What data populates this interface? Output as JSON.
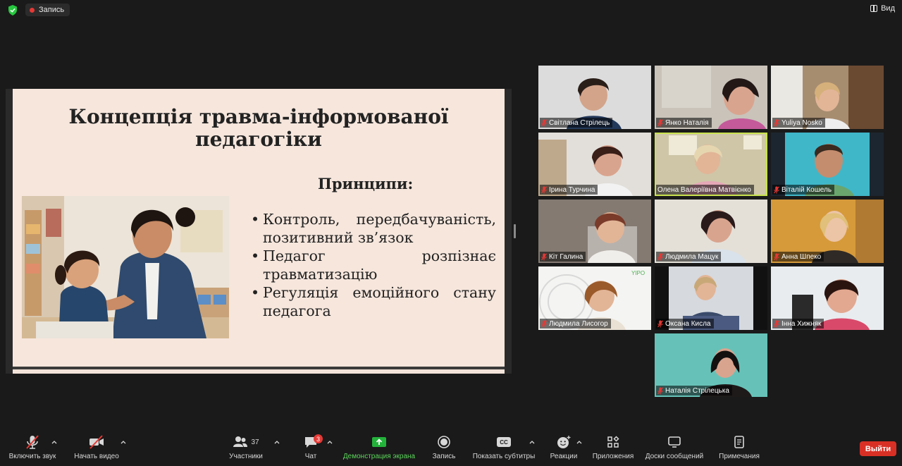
{
  "top_bar": {
    "recording_label": "Запись",
    "view_label": "Вид"
  },
  "slide": {
    "title_line1": "Концепція травма-інформованої",
    "title_line2": "педагогіки",
    "principles_heading": "Принципи:",
    "bullets": [
      "Контроль, передбачуваність, позитивний зв’язок",
      "Педагог розпізнає травматизацію",
      "Регуляція емоційного стану педагога"
    ]
  },
  "participants": [
    {
      "name": "Світлана Стрілець"
    },
    {
      "name": "Янко Наталія"
    },
    {
      "name": "Yuliya Nosko"
    },
    {
      "name": "Ірина Турчина"
    },
    {
      "name": "Олена Валеріївна Матвієнко"
    },
    {
      "name": "Віталій Кошель"
    },
    {
      "name": "Кіт Галина"
    },
    {
      "name": "Людмила Мацук"
    },
    {
      "name": "Анна Шпеко"
    },
    {
      "name": "Людмила Лисогор"
    },
    {
      "name": "Оксана Кисла"
    },
    {
      "name": "Інна Хижняк"
    },
    {
      "name": "Наталія Стрілецька"
    }
  ],
  "toolbar": {
    "unmute": "Включить звук",
    "start_video": "Начать видео",
    "participants": "Участники",
    "participants_count": "37",
    "chat": "Чат",
    "chat_badge": "3",
    "share_screen": "Демонстрация экрана",
    "record": "Запись",
    "captions": "Показать субтитры",
    "captions_icon_text": "CC",
    "reactions": "Реакции",
    "apps": "Приложения",
    "whiteboards": "Доски сообщений",
    "notes": "Примечания",
    "leave": "Выйти"
  },
  "colors": {
    "share_green": "#5cd65c",
    "leave_red": "#d93025",
    "active_speaker": "#c9e34f",
    "slide_bg": "#f6e6dc"
  }
}
